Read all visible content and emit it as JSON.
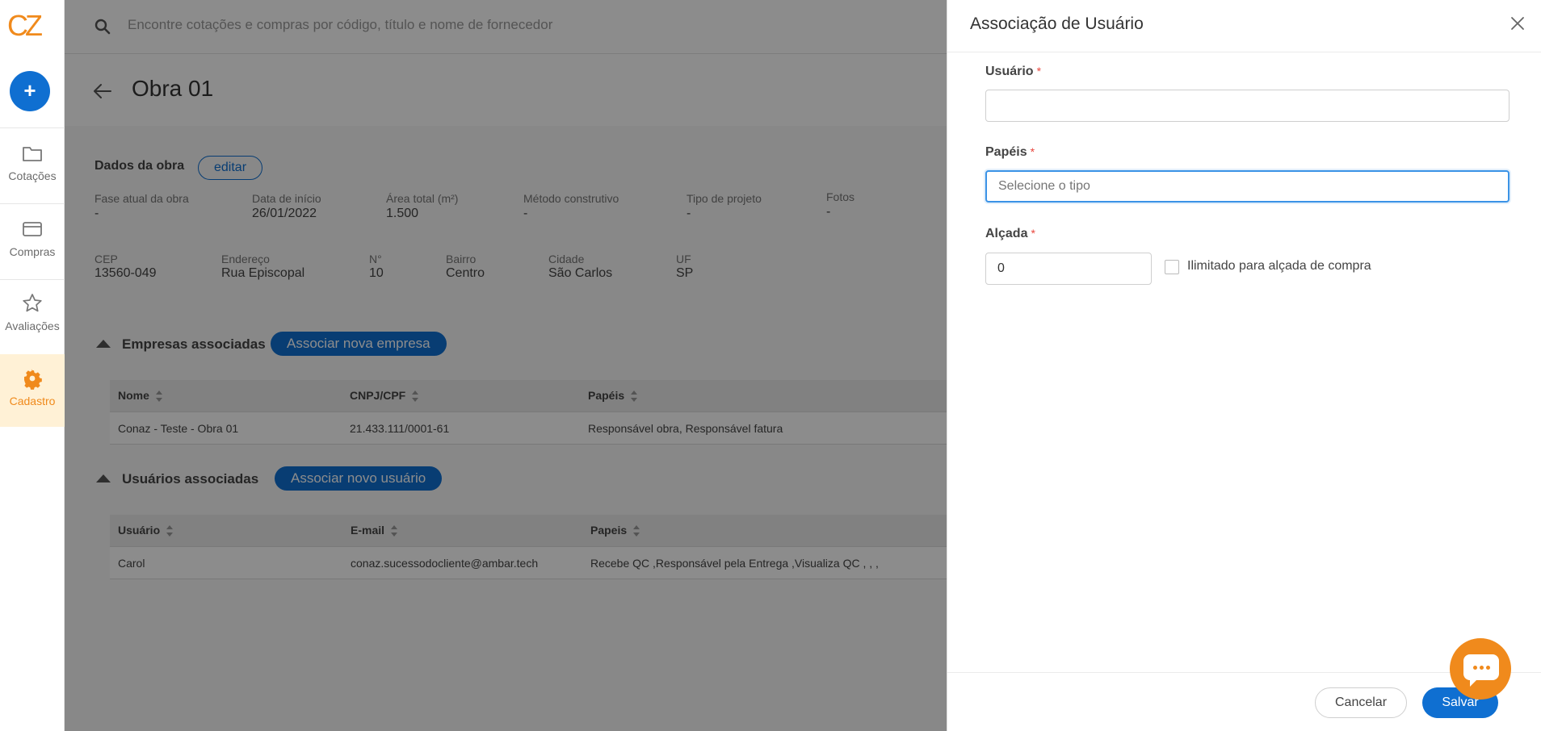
{
  "app": {
    "logo_text": "CZ",
    "new_button": "+"
  },
  "sidebar": {
    "items": [
      {
        "label": "Cotações"
      },
      {
        "label": "Compras"
      },
      {
        "label": "Avaliações"
      },
      {
        "label": "Cadastro"
      }
    ]
  },
  "search": {
    "placeholder": "Encontre cotações e compras por código, título e nome de fornecedor"
  },
  "page": {
    "title": "Obra 01"
  },
  "dados": {
    "title": "Dados da obra",
    "edit_label": "editar",
    "row1": [
      {
        "label": "Fase atual da obra",
        "value": "-"
      },
      {
        "label": "Data de início",
        "value": "26/01/2022"
      },
      {
        "label": "Área total (m²)",
        "value": "1.500"
      },
      {
        "label": "Método construtivo",
        "value": "-"
      },
      {
        "label": "Tipo de projeto",
        "value": "-"
      },
      {
        "label": "Fotos",
        "value": "-"
      }
    ],
    "row2": [
      {
        "label": "CEP",
        "value": "13560-049"
      },
      {
        "label": "Endereço",
        "value": "Rua Episcopal"
      },
      {
        "label": "N°",
        "value": "10"
      },
      {
        "label": "Bairro",
        "value": "Centro"
      },
      {
        "label": "Cidade",
        "value": "São Carlos"
      },
      {
        "label": "UF",
        "value": "SP"
      }
    ]
  },
  "empresas": {
    "title": "Empresas associadas",
    "button": "Associar nova empresa",
    "columns": [
      "Nome",
      "CNPJ/CPF",
      "Papéis"
    ],
    "rows": [
      [
        "Conaz - Teste - Obra 01",
        "21.433.111/0001-61",
        "Responsável obra, Responsável fatura"
      ]
    ]
  },
  "usuarios": {
    "title": "Usuários associadas",
    "button": "Associar novo usuário",
    "columns": [
      "Usuário",
      "E-mail",
      "Papeis"
    ],
    "rows": [
      [
        "Carol",
        "conaz.sucessodocliente@ambar.tech",
        "Recebe QC ,Responsável pela Entrega ,Visualiza QC , , ,"
      ]
    ]
  },
  "drawer": {
    "title": "Associação de Usuário",
    "usuario_label": "Usuário",
    "usuario_value": "",
    "papeis_label": "Papéis",
    "papeis_placeholder": "Selecione o tipo",
    "alcada_label": "Alçada",
    "alcada_value": "0",
    "ilimitado_label": "Ilimitado para alçada de compra",
    "ilimitado_checked": false,
    "required_mark": "*",
    "cancel_label": "Cancelar",
    "save_label": "Salvar"
  },
  "colors": {
    "accent": "#0f6fd1",
    "brand": "#f08a1c",
    "active_bg": "#fff1d6",
    "required": "#e8453c"
  }
}
